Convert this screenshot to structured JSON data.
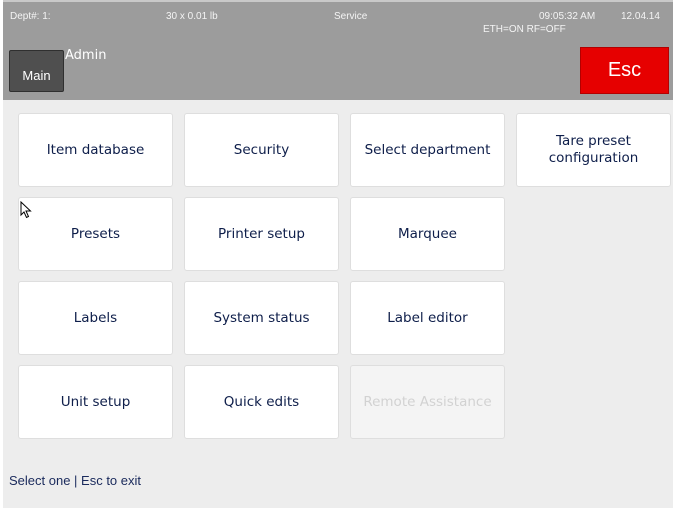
{
  "status_bar": {
    "dept": "Dept#: 1:",
    "units": "30 x 0.01 lb",
    "mode": "Service",
    "time": "09:05:32 AM",
    "date": "12.04.14",
    "network": "ETH=ON  RF=OFF"
  },
  "header": {
    "main_label": "Main",
    "user_label": "Admin",
    "esc_label": "Esc"
  },
  "menu": {
    "items": [
      {
        "label": "Item database",
        "enabled": true
      },
      {
        "label": "Security",
        "enabled": true
      },
      {
        "label": "Select department",
        "enabled": true
      },
      {
        "label_lines": [
          "Tare preset",
          "configuration"
        ],
        "enabled": true
      },
      {
        "label": "Presets",
        "enabled": true
      },
      {
        "label": "Printer setup",
        "enabled": true
      },
      {
        "label": "Marquee",
        "enabled": true
      },
      {
        "label": "Labels",
        "enabled": true
      },
      {
        "label": "System status",
        "enabled": true
      },
      {
        "label": "Label editor",
        "enabled": true
      },
      {
        "label": "Unit setup",
        "enabled": true
      },
      {
        "label": "Quick edits",
        "enabled": true
      },
      {
        "label": "Remote Assistance",
        "enabled": false
      }
    ]
  },
  "footer": {
    "hint": "Select one | Esc to exit"
  },
  "colors": {
    "topbar": "#9c9c9c",
    "esc": "#e60000",
    "main_button": "#4f4f4f",
    "content_bg": "#ededed",
    "tile_text": "#0e1e4a",
    "disabled_text": "#d2d2d2"
  },
  "icons": {
    "cursor": "mouse-pointer-icon"
  }
}
